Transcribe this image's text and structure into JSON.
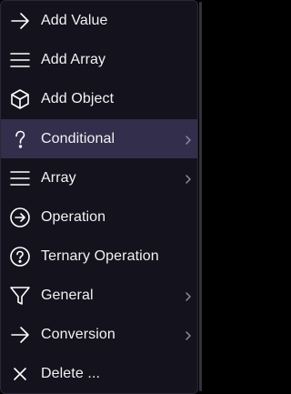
{
  "menu": {
    "items": [
      {
        "label": "Add Value",
        "icon": "arrow-right-icon",
        "submenu": false
      },
      {
        "label": "Add Array",
        "icon": "hamburger-icon",
        "submenu": false
      },
      {
        "label": "Add Object",
        "icon": "cube-icon",
        "submenu": false
      },
      {
        "label": "Conditional",
        "icon": "question-mark-icon",
        "submenu": true,
        "highlighted": true
      },
      {
        "label": "Array",
        "icon": "hamburger-icon",
        "submenu": true
      },
      {
        "label": "Operation",
        "icon": "circle-arrow-right-icon",
        "submenu": false
      },
      {
        "label": "Ternary Operation",
        "icon": "circle-question-icon",
        "submenu": false
      },
      {
        "label": "General",
        "icon": "funnel-icon",
        "submenu": true
      },
      {
        "label": "Conversion",
        "icon": "arrow-right-icon",
        "submenu": true
      },
      {
        "label": "Delete ...",
        "icon": "x-icon",
        "submenu": false
      }
    ]
  },
  "colors": {
    "menu_background": "#14121c",
    "highlight_background": "#322e4c",
    "text": "#f2f2f4",
    "chevron": "#8e8c9a"
  }
}
